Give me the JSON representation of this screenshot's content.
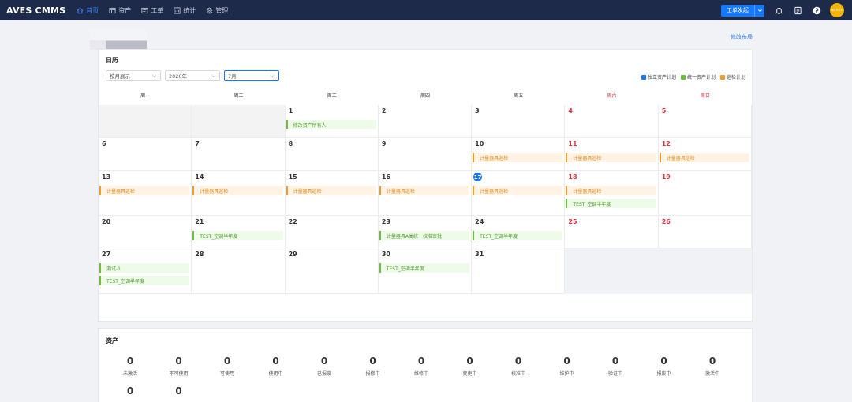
{
  "app": {
    "logo": "AVES CMMS"
  },
  "nav": [
    {
      "label": "首页",
      "icon": "home-icon",
      "active": true
    },
    {
      "label": "资产",
      "icon": "asset-icon",
      "active": false
    },
    {
      "label": "工单",
      "icon": "workorder-icon",
      "active": false
    },
    {
      "label": "统计",
      "icon": "stats-icon",
      "active": false
    },
    {
      "label": "管理",
      "icon": "manage-icon",
      "active": false
    }
  ],
  "header": {
    "primary_button": "工单发起",
    "avatar_text": "admin"
  },
  "page": {
    "edit_layout": "修改布局"
  },
  "calendar": {
    "title": "日历",
    "filters": {
      "mode": "按月展示",
      "year": "2026年",
      "month": "7月"
    },
    "legend": [
      {
        "label": "独立资产计划",
        "color": "#1677ff"
      },
      {
        "label": "统一资产计划",
        "color": "#67c23a"
      },
      {
        "label": "巡检计划",
        "color": "#f59a23"
      }
    ],
    "weekdays": [
      "周一",
      "周二",
      "周三",
      "周四",
      "周五",
      "周六",
      "周日"
    ],
    "today": 17,
    "weeks": [
      [
        null,
        null,
        {
          "day": "1",
          "events": [
            {
              "text": "修改资产所有人",
              "type": "green"
            }
          ]
        },
        {
          "day": "2",
          "events": []
        },
        {
          "day": "3",
          "events": []
        },
        {
          "day": "4",
          "events": []
        },
        {
          "day": "5",
          "events": []
        }
      ],
      [
        {
          "day": "6",
          "events": []
        },
        {
          "day": "7",
          "events": []
        },
        {
          "day": "8",
          "events": []
        },
        {
          "day": "9",
          "events": []
        },
        {
          "day": "10",
          "events": [
            {
              "text": "计量器具巡检",
              "type": "orange"
            }
          ]
        },
        {
          "day": "11",
          "events": [
            {
              "text": "计量器具巡检",
              "type": "orange"
            }
          ]
        },
        {
          "day": "12",
          "events": [
            {
              "text": "计量器具巡检",
              "type": "orange"
            }
          ]
        }
      ],
      [
        {
          "day": "13",
          "events": [
            {
              "text": "计量器具巡检",
              "type": "orange"
            }
          ]
        },
        {
          "day": "14",
          "events": [
            {
              "text": "计量器具巡检",
              "type": "orange"
            }
          ]
        },
        {
          "day": "15",
          "events": [
            {
              "text": "计量器具巡检",
              "type": "orange"
            }
          ]
        },
        {
          "day": "16",
          "events": [
            {
              "text": "计量器具巡检",
              "type": "orange"
            }
          ]
        },
        {
          "day": "17",
          "events": [
            {
              "text": "计量器具巡检",
              "type": "orange"
            }
          ]
        },
        {
          "day": "18",
          "events": [
            {
              "text": "计量器具巡检",
              "type": "orange"
            },
            {
              "text": "TEST_空调半年度",
              "type": "green"
            }
          ]
        },
        {
          "day": "19",
          "events": []
        }
      ],
      [
        {
          "day": "20",
          "events": []
        },
        {
          "day": "21",
          "events": [
            {
              "text": "TEST_空调半年度",
              "type": "green"
            }
          ]
        },
        {
          "day": "22",
          "events": []
        },
        {
          "day": "23",
          "events": [
            {
              "text": "计量器具A类统一校准审批",
              "type": "green"
            }
          ]
        },
        {
          "day": "24",
          "events": [
            {
              "text": "TEST_空调半年度",
              "type": "green"
            }
          ]
        },
        {
          "day": "25",
          "events": []
        },
        {
          "day": "26",
          "events": []
        }
      ],
      [
        {
          "day": "27",
          "events": [
            {
              "text": "测试-1",
              "type": "green"
            },
            {
              "text": "TEST_空调半年度",
              "type": "green"
            }
          ]
        },
        {
          "day": "28",
          "events": []
        },
        {
          "day": "29",
          "events": []
        },
        {
          "day": "30",
          "events": [
            {
              "text": "TEST_空调半年度",
              "type": "green"
            }
          ]
        },
        {
          "day": "31",
          "events": []
        },
        null,
        null
      ]
    ]
  },
  "assets": {
    "title": "资产",
    "stats": [
      {
        "value": "0",
        "label": "未激活"
      },
      {
        "value": "0",
        "label": "不可使用"
      },
      {
        "value": "0",
        "label": "可使用"
      },
      {
        "value": "0",
        "label": "使用中"
      },
      {
        "value": "0",
        "label": "已报废"
      },
      {
        "value": "0",
        "label": "报修中"
      },
      {
        "value": "0",
        "label": "维修中"
      },
      {
        "value": "0",
        "label": "变更中"
      },
      {
        "value": "0",
        "label": "校准中"
      },
      {
        "value": "0",
        "label": "维护中"
      },
      {
        "value": "0",
        "label": "验证中"
      },
      {
        "value": "0",
        "label": "报废中"
      },
      {
        "value": "0",
        "label": "激活中"
      },
      {
        "value": "0",
        "label": ""
      },
      {
        "value": "0",
        "label": ""
      }
    ]
  }
}
